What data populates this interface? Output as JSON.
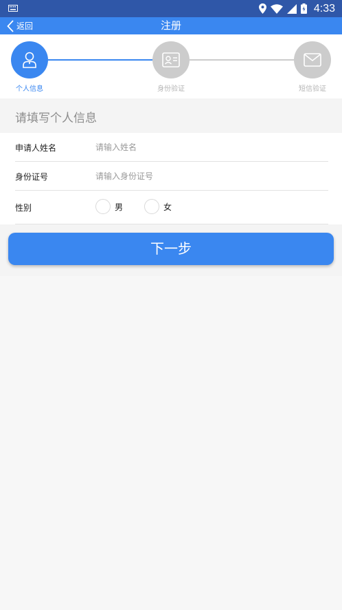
{
  "status_bar": {
    "time": "4:33",
    "icons": [
      "keyboard-icon",
      "location-icon",
      "wifi-icon",
      "signal-icon",
      "battery-icon"
    ]
  },
  "nav": {
    "back_label": "返回",
    "title": "注册"
  },
  "steps": [
    {
      "label": "个人信息",
      "icon": "user-icon",
      "active": true
    },
    {
      "label": "身份验证",
      "icon": "id-card-icon",
      "active": false
    },
    {
      "label": "短信验证",
      "icon": "envelope-icon",
      "active": false
    }
  ],
  "section_title": "请填写个人信息",
  "form": {
    "name": {
      "label": "申请人姓名",
      "placeholder": "请输入姓名",
      "value": ""
    },
    "id_number": {
      "label": "身份证号",
      "placeholder": "请输入身份证号",
      "value": ""
    },
    "gender": {
      "label": "性别",
      "options": [
        "男",
        "女"
      ]
    }
  },
  "next_button": "下一步",
  "colors": {
    "status_bar": "#2f57a8",
    "accent": "#3a87f0",
    "inactive_step": "#cccccc"
  }
}
